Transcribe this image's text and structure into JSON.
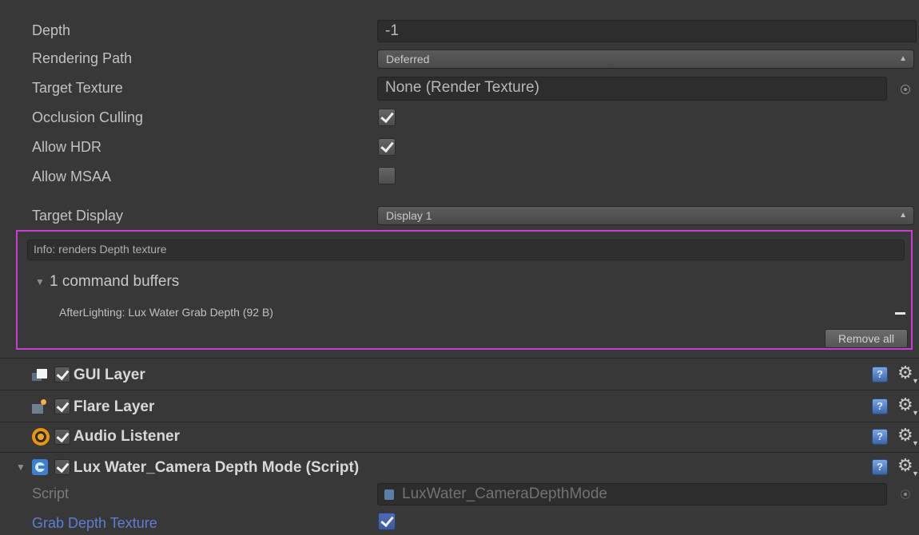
{
  "camera": {
    "depth": {
      "label": "Depth",
      "value": "-1"
    },
    "rendering_path": {
      "label": "Rendering Path",
      "value": "Deferred"
    },
    "target_texture": {
      "label": "Target Texture",
      "value": "None (Render Texture)"
    },
    "occlusion_culling": {
      "label": "Occlusion Culling",
      "checked": true
    },
    "allow_hdr": {
      "label": "Allow HDR",
      "checked": true
    },
    "allow_msaa": {
      "label": "Allow MSAA",
      "checked": false
    },
    "target_display": {
      "label": "Target Display",
      "value": "Display 1"
    }
  },
  "info": {
    "message": "Info: renders Depth texture",
    "command_buffers_title": "1 command buffers",
    "buffer_entry": "AfterLighting: Lux Water Grab Depth (92 B)",
    "remove_all_label": "Remove all"
  },
  "components": [
    {
      "label": "GUI Layer",
      "icon": "gui-layer-icon",
      "enabled": true
    },
    {
      "label": "Flare Layer",
      "icon": "flare-layer-icon",
      "enabled": true
    },
    {
      "label": "Audio Listener",
      "icon": "audio-listener-icon",
      "enabled": true
    },
    {
      "label": "Lux Water_Camera Depth Mode (Script)",
      "icon": "script-icon",
      "enabled": true
    }
  ],
  "script": {
    "script_label": "Script",
    "script_value": "LuxWater_CameraDepthMode",
    "grab_label": "Grab Depth Texture",
    "grab_checked": true
  },
  "colors": {
    "background": "#383838",
    "highlight_border": "#c93ed1",
    "blue_label": "#5b7fd6"
  }
}
